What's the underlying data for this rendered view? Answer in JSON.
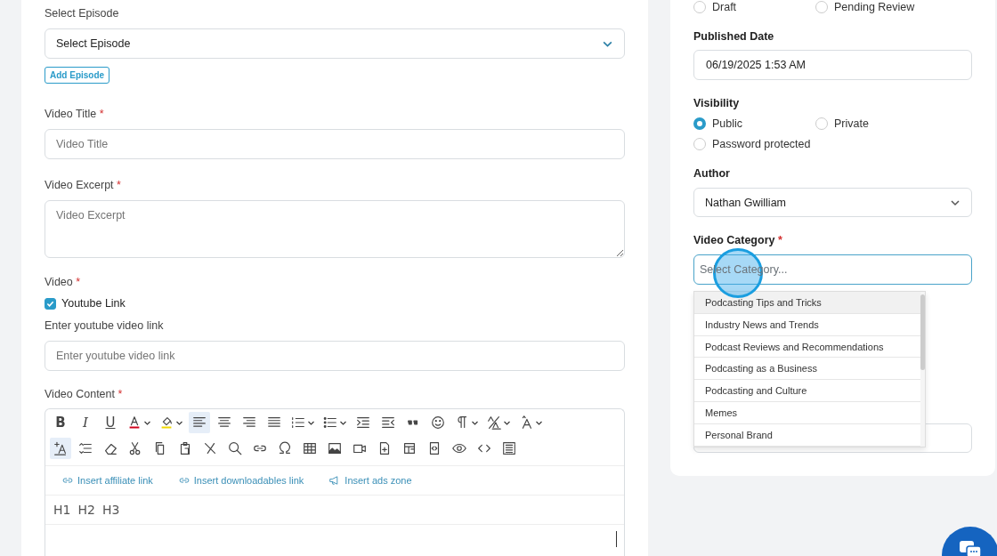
{
  "left": {
    "episode": {
      "label": "Select Episode",
      "value": "Select Episode",
      "button": "Add Episode"
    },
    "video_title": {
      "label": "Video Title",
      "mark": "*",
      "placeholder": "Video Title"
    },
    "video_excerpt": {
      "label": "Video Excerpt",
      "mark": "*",
      "placeholder": "Video Excerpt"
    },
    "video": {
      "label": "Video",
      "mark": "*",
      "checkbox": {
        "label": "Youtube Link",
        "checked": true
      },
      "link_label": "Enter youtube video link",
      "placeholder": "Enter youtube video link"
    },
    "content": {
      "label": "Video Content",
      "mark": "*",
      "toolbar": [
        [
          {
            "kind": "bold",
            "text": "B",
            "selected": false,
            "menu": false
          },
          {
            "kind": "italic",
            "text": "I",
            "selected": false,
            "menu": false
          },
          {
            "kind": "underline",
            "text": "U",
            "selected": false,
            "menu": false
          },
          {
            "kind": "font-color",
            "selected": false,
            "menu": true
          },
          {
            "kind": "highlight",
            "selected": false,
            "menu": true
          },
          {
            "kind": "align-left",
            "selected": true,
            "menu": false
          },
          {
            "kind": "align-center",
            "selected": false,
            "menu": false
          },
          {
            "kind": "align-right",
            "selected": false,
            "menu": false
          },
          {
            "kind": "justify",
            "selected": false,
            "menu": false
          },
          {
            "kind": "ordered-list",
            "selected": false,
            "menu": true
          },
          {
            "kind": "bullet-list",
            "selected": false,
            "menu": true
          },
          {
            "kind": "indent",
            "selected": false,
            "menu": false
          },
          {
            "kind": "outdent",
            "selected": false,
            "menu": false
          },
          {
            "kind": "quote",
            "selected": false,
            "menu": false
          },
          {
            "kind": "emoji",
            "selected": false,
            "menu": false
          },
          {
            "kind": "paragraph",
            "selected": false,
            "menu": true
          },
          {
            "kind": "strike-size",
            "selected": false,
            "menu": true
          },
          {
            "kind": "font-size",
            "selected": false,
            "menu": true
          }
        ],
        [
          {
            "kind": "add-text",
            "selected": true,
            "menu": false
          },
          {
            "kind": "line-height",
            "selected": false,
            "menu": false
          },
          {
            "kind": "eraser",
            "selected": false,
            "menu": false
          },
          {
            "kind": "cut",
            "selected": false,
            "menu": false
          },
          {
            "kind": "copy",
            "selected": false,
            "menu": false
          },
          {
            "kind": "paste",
            "selected": false,
            "menu": false
          },
          {
            "kind": "remove",
            "selected": false,
            "menu": false
          },
          {
            "kind": "search",
            "selected": false,
            "menu": false
          },
          {
            "kind": "link",
            "selected": false,
            "menu": false
          },
          {
            "kind": "omega",
            "selected": false,
            "menu": false
          },
          {
            "kind": "table",
            "selected": false,
            "menu": false
          },
          {
            "kind": "image",
            "selected": false,
            "menu": false
          },
          {
            "kind": "video",
            "selected": false,
            "menu": false
          },
          {
            "kind": "file-plus",
            "selected": false,
            "menu": false
          },
          {
            "kind": "layout",
            "selected": false,
            "menu": false
          },
          {
            "kind": "code-block",
            "selected": false,
            "menu": false
          },
          {
            "kind": "eye",
            "selected": false,
            "menu": false
          },
          {
            "kind": "code",
            "selected": false,
            "menu": false
          },
          {
            "kind": "select-all",
            "selected": false,
            "menu": false
          }
        ]
      ],
      "links": [
        {
          "kind": "link",
          "label": "Insert affiliate link"
        },
        {
          "kind": "link",
          "label": "Insert downloadables link"
        },
        {
          "kind": "megaphone",
          "label": "Insert ads zone"
        }
      ],
      "headings": [
        "H1",
        "H2",
        "H3"
      ]
    }
  },
  "right": {
    "status_options": [
      {
        "label": "Draft",
        "selected": false
      },
      {
        "label": "Pending Review",
        "selected": false
      }
    ],
    "published_date": {
      "label": "Published Date",
      "value": "06/19/2025 1:53 AM"
    },
    "visibility": {
      "label": "Visibility",
      "options": [
        {
          "label": "Public",
          "selected": true
        },
        {
          "label": "Private",
          "selected": false
        },
        {
          "label": "Password protected",
          "selected": false
        }
      ]
    },
    "author": {
      "label": "Author",
      "value": "Nathan Gwilliam"
    },
    "category": {
      "label": "Video Category",
      "mark": "*",
      "placeholder": "Select Category...",
      "expanded": true,
      "options": [
        {
          "label": "Podcasting Tips and Tricks",
          "highlighted": true
        },
        {
          "label": "Industry News and Trends",
          "highlighted": false
        },
        {
          "label": "Podcast Reviews and Recommendations",
          "highlighted": false
        },
        {
          "label": "Podcasting as a Business",
          "highlighted": false
        },
        {
          "label": "Podcasting and Culture",
          "highlighted": false
        },
        {
          "label": "Memes",
          "highlighted": false
        },
        {
          "label": "Personal Brand",
          "highlighted": false
        }
      ]
    }
  }
}
